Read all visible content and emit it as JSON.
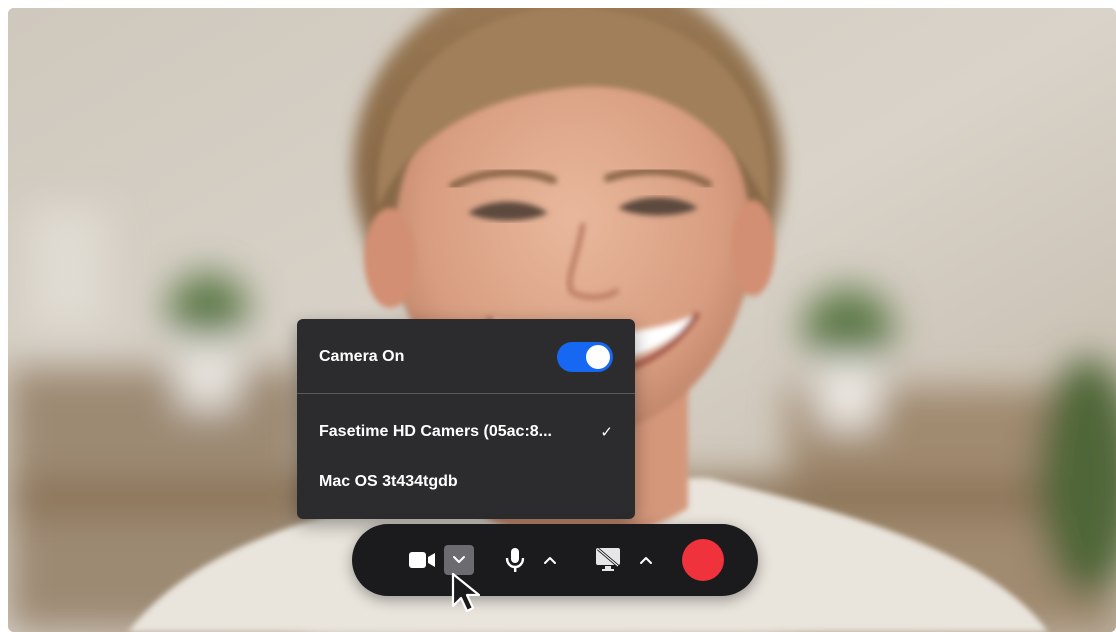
{
  "camera_menu": {
    "camera_on_label": "Camera On",
    "camera_on_enabled": true,
    "devices": [
      {
        "label": "Fasetime HD Camers (05ac:8...",
        "selected": true
      },
      {
        "label": "Mac OS 3t434tgdb",
        "selected": false
      }
    ],
    "selected_glyph": "✓"
  },
  "toolbar": {
    "camera_icon": "video-camera-icon",
    "camera_options_icon": "chevron-down-icon",
    "mic_icon": "microphone-icon",
    "mic_options_icon": "chevron-up-icon",
    "screen_icon": "screen-share-off-icon",
    "screen_options_icon": "chevron-up-icon",
    "record_icon": "record-button"
  },
  "colors": {
    "menu_bg": "#2c2c2e",
    "toggle_on": "#1668f2",
    "toolbar_bg": "#1b1b1d",
    "record": "#f0323c"
  }
}
